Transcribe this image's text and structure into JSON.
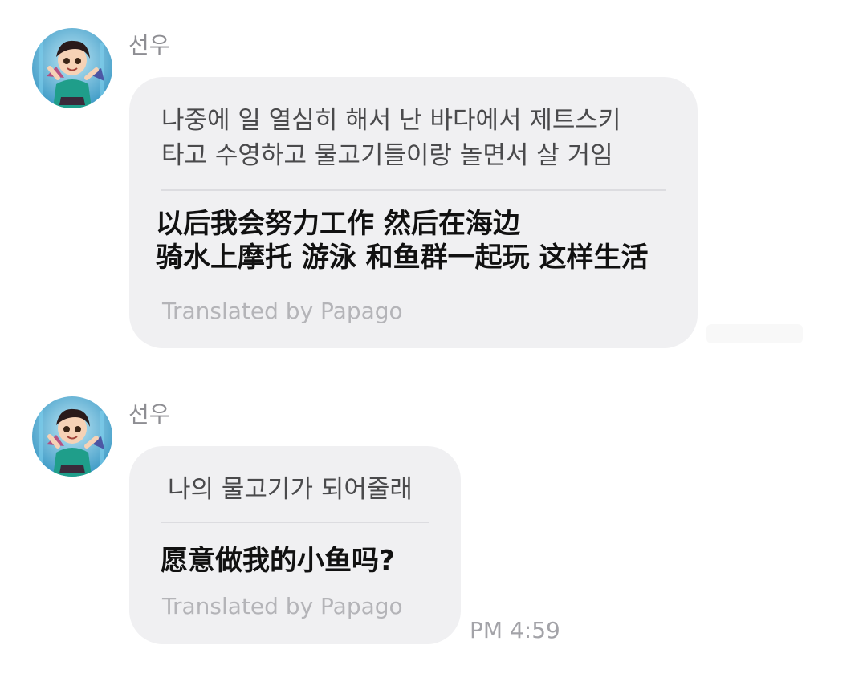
{
  "messages": [
    {
      "sender": "선우",
      "original_lines": [
        "나중에 일 열심히 해서 난 바다에서 제트스키",
        "타고 수영하고 물고기들이랑 놀면서 살 거임"
      ],
      "translation_lines": [
        "以后我会努力工作 然后在海边",
        "骑水上摩托 游泳 和鱼群一起玩 这样生活"
      ],
      "translated_by": "Translated by Papago"
    },
    {
      "sender": "선우",
      "original_lines": [
        "나의 물고기가 되어줄래"
      ],
      "translation_lines": [
        "愿意做我的小鱼吗?"
      ],
      "translated_by": "Translated by Papago",
      "time": "PM 4:59"
    }
  ],
  "colors": {
    "bubble_bg": "#f0f0f2",
    "sender_text": "#8e8e93",
    "translation_text": "#111111",
    "papago_text": "#b4b4b8"
  },
  "icons": {
    "avatar": "cartoon-girl-avatar-icon"
  }
}
